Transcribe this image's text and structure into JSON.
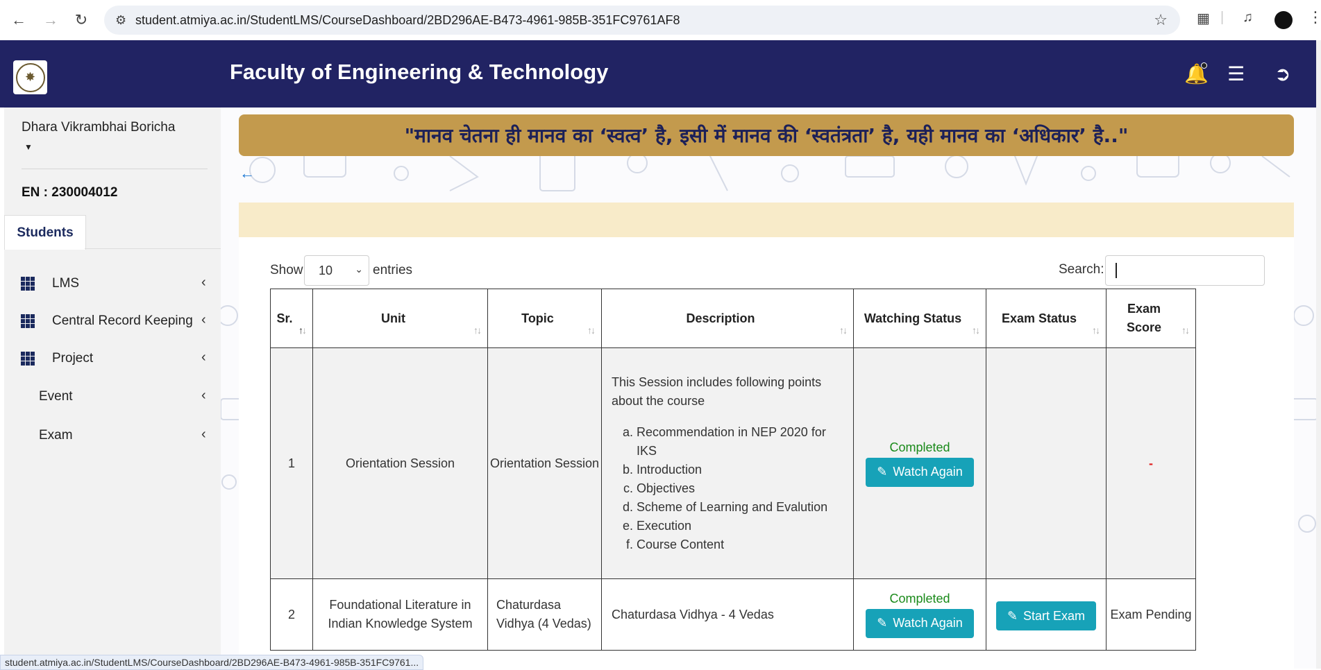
{
  "browser": {
    "url": "student.atmiya.ac.in/StudentLMS/CourseDashboard/2BD296AE-B473-4961-985B-351FC9761AF8",
    "status_url": "student.atmiya.ac.in/StudentLMS/CourseDashboard/2BD296AE-B473-4961-985B-351FC9761..."
  },
  "header": {
    "title": "Faculty of Engineering & Technology"
  },
  "sidebar": {
    "user_name": "Dhara Vikrambhai Boricha",
    "enrollment": "EN : 230004012",
    "tab": "Students",
    "items": [
      {
        "label": "LMS"
      },
      {
        "label": "Central Record Keeping"
      },
      {
        "label": "Project"
      },
      {
        "label": "Event"
      },
      {
        "label": "Exam"
      }
    ]
  },
  "banner": {
    "quote": "\"मानव चेतना ही मानव का ‘स्वत्व’ है, इसी में मानव की ‘स्वतंत्रता’ है, यही मानव का ‘अधिकार’ है..\""
  },
  "table_controls": {
    "show": "Show",
    "entries_value": "10",
    "entries": "entries",
    "search_label": "Search:"
  },
  "table": {
    "headers": [
      "Sr.",
      "Unit",
      "Topic",
      "Description",
      "Watching Status",
      "Exam Status",
      "Exam Score"
    ],
    "rows": [
      {
        "sr": "1",
        "unit": "Orientation Session",
        "topic": "Orientation Session",
        "desc_intro": "This Session includes following points about the course",
        "desc_points": [
          "Recommendation in NEP 2020 for IKS",
          "Introduction",
          "Objectives",
          "Scheme of Learning and Evalution",
          "Execution",
          "Course Content"
        ],
        "watching_status": "Completed",
        "watch_button": "Watch Again",
        "exam_status": "",
        "exam_score": "-"
      },
      {
        "sr": "2",
        "unit": "Foundational Literature in Indian Knowledge System",
        "topic": "Chaturdasa Vidhya (4 Vedas)",
        "description": "Chaturdasa Vidhya - 4 Vedas",
        "watching_status": "Completed",
        "watch_button": "Watch Again",
        "exam_button": "Start Exam",
        "exam_score": "Exam Pending"
      }
    ]
  },
  "colors": {
    "header_bg": "#212363",
    "banner_bg": "#c39a4d",
    "button_bg": "#17a2b8",
    "completed": "#1a8a1a"
  }
}
